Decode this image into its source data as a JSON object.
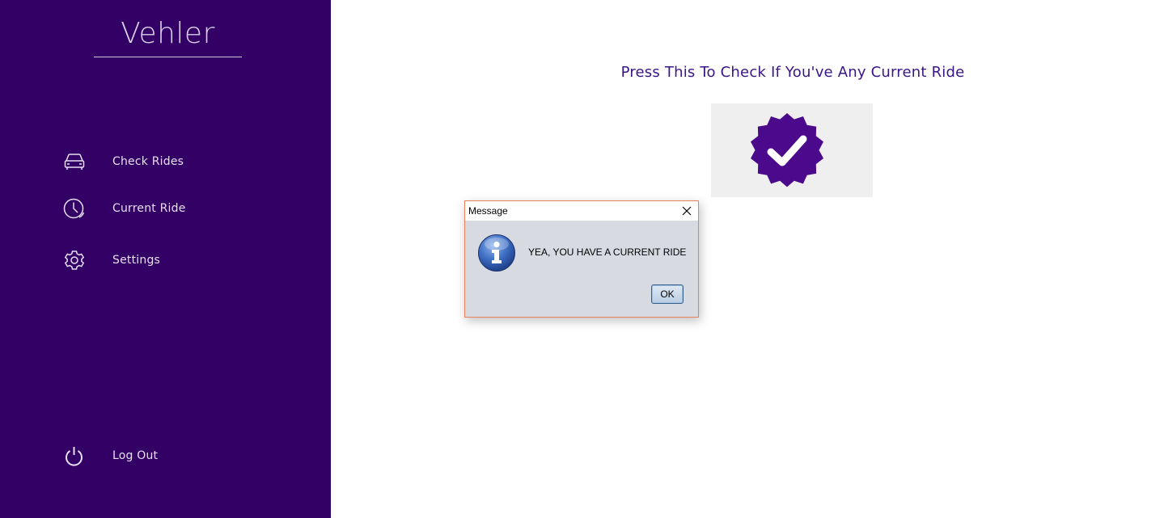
{
  "sidebar": {
    "brand": "Vehler",
    "background_color": "#330066",
    "items": [
      {
        "label": "Check Rides",
        "icon": "car-icon"
      },
      {
        "label": "Current Ride",
        "icon": "clock-icon"
      },
      {
        "label": "Settings",
        "icon": "gear-icon"
      }
    ],
    "logout": {
      "label": "Log Out",
      "icon": "power-icon"
    }
  },
  "main": {
    "headline": "Press This To Check If You've Any Current Ride",
    "check_button": {
      "icon": "verified-badge-icon",
      "accent_color": "#4b0a8c"
    }
  },
  "dialog": {
    "title": "Message",
    "message": "YEA, YOU HAVE A CURRENT RIDE",
    "icon": "info-icon",
    "ok_label": "OK",
    "close_icon": "close-icon"
  }
}
